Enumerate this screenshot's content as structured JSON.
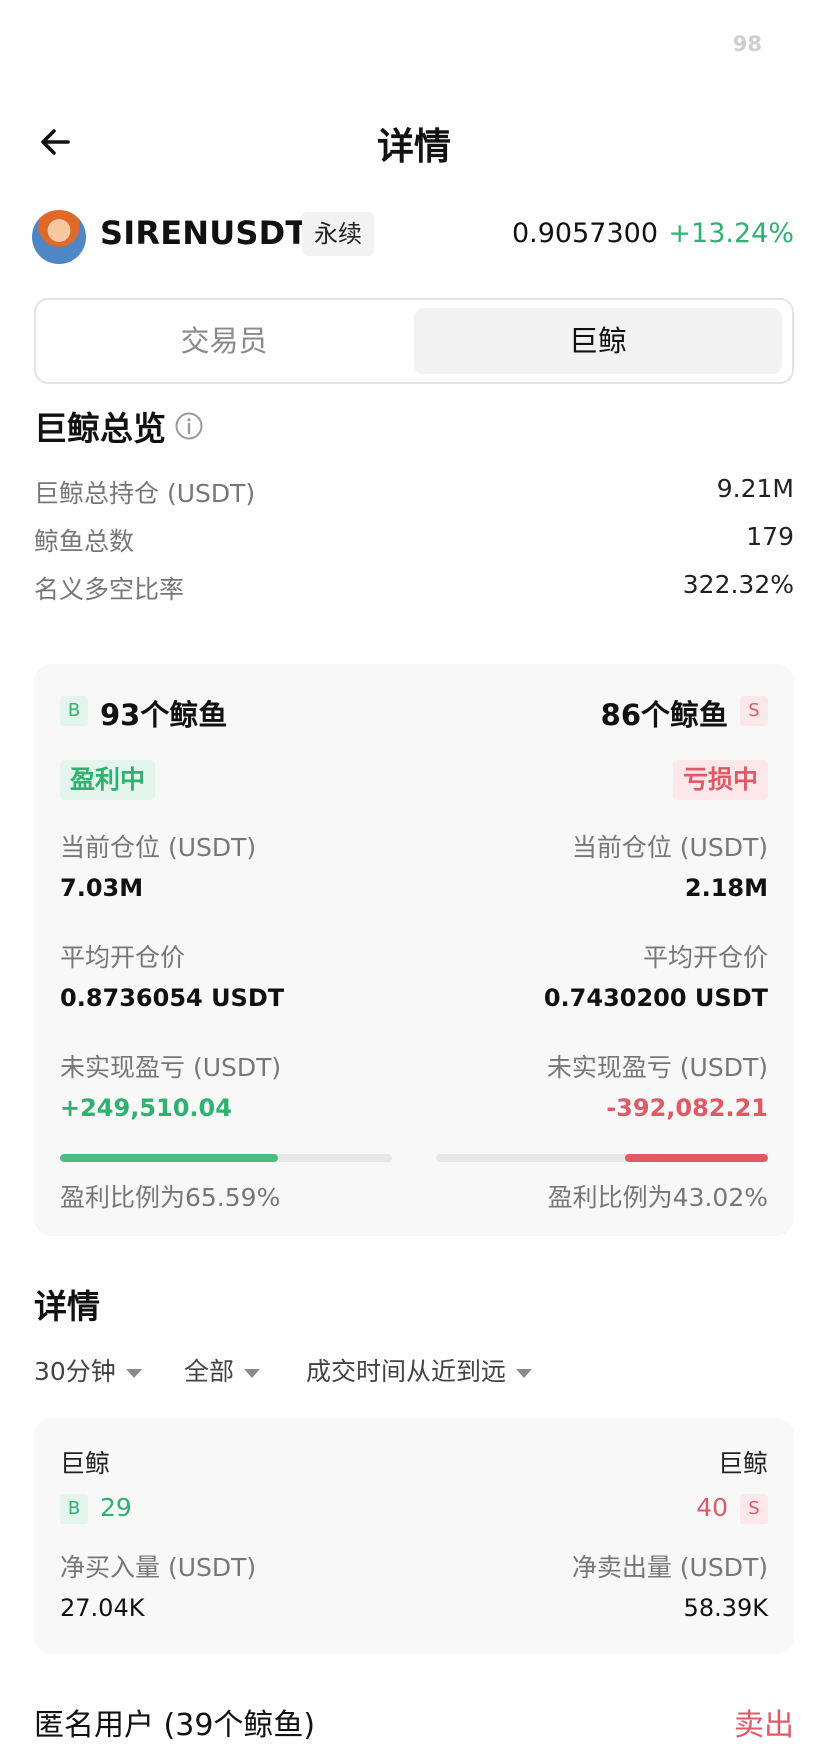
{
  "status": {
    "number": "98"
  },
  "header": {
    "title": "详情"
  },
  "ticker": {
    "symbol": "SIRENUSDT",
    "contract_tag": "永续",
    "price": "0.9057300",
    "change": "+13.24%"
  },
  "tabs": {
    "trader": "交易员",
    "whale": "巨鲸",
    "selected": "巨鲸"
  },
  "overview": {
    "title": "巨鲸总览",
    "rows": [
      {
        "label": "巨鲸总持仓 (USDT)",
        "value": "9.21M"
      },
      {
        "label": "鲸鱼总数",
        "value": "179"
      },
      {
        "label": "名义多空比率",
        "value": "322.32%"
      }
    ]
  },
  "long_side": {
    "badge": "B",
    "count": "93个鲸鱼",
    "status": "盈利中",
    "position_label": "当前仓位 (USDT)",
    "position_value": "7.03M",
    "avg_price_label": "平均开仓价",
    "avg_price_value": "0.8736054 USDT",
    "pnl_label": "未实现盈亏 (USDT)",
    "pnl_value": "+249,510.04",
    "profit_ratio_text": "盈利比例为65.59%",
    "profit_ratio": 0.6559
  },
  "short_side": {
    "badge": "S",
    "count": "86个鲸鱼",
    "status": "亏损中",
    "position_label": "当前仓位 (USDT)",
    "position_value": "2.18M",
    "avg_price_label": "平均开仓价",
    "avg_price_value": "0.7430200 USDT",
    "pnl_label": "未实现盈亏 (USDT)",
    "pnl_value": "-392,082.21",
    "profit_ratio_text": "盈利比例为43.02%",
    "profit_ratio": 0.4302
  },
  "details": {
    "title": "详情",
    "filters": [
      "30分钟",
      "全部",
      "成交时间从近到远"
    ],
    "buy": {
      "label": "巨鲸",
      "badge": "B",
      "count": "29",
      "amount_label": "净买入量 (USDT)",
      "amount": "27.04K"
    },
    "sell": {
      "label": "巨鲸",
      "badge": "S",
      "count": "40",
      "amount_label": "净卖出量 (USDT)",
      "amount": "58.39K"
    }
  },
  "anon": {
    "title": "匿名用户 (39个鲸鱼)",
    "action": "卖出"
  },
  "colors": {
    "green": "#2fb16f",
    "red": "#e05a66"
  },
  "icons": {
    "back": "arrow-left-icon",
    "info": "info-circle-icon",
    "dropdown": "caret-down-icon"
  }
}
